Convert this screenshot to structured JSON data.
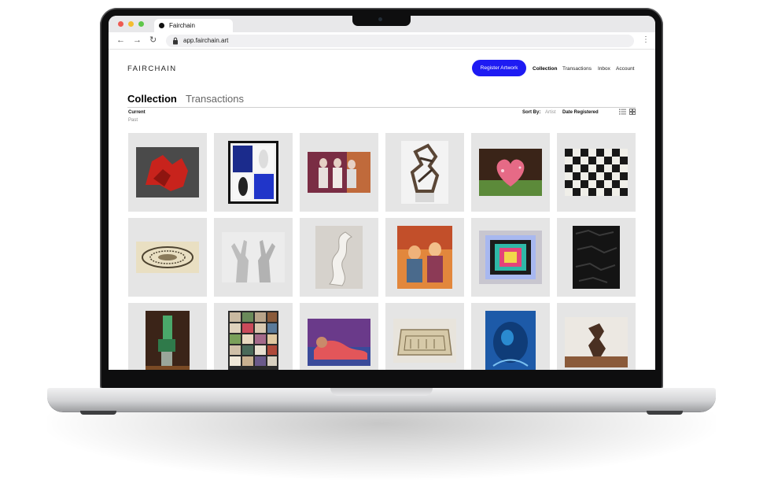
{
  "browser": {
    "tab_title": "Fairchain",
    "url": "app.fairchain.art"
  },
  "header": {
    "logo": "FAIRCHAIN",
    "register_button": "Register Artwork",
    "nav": [
      "Collection",
      "Transactions",
      "Inbox",
      "Account"
    ],
    "active_nav": "Collection"
  },
  "page": {
    "tabs": [
      "Collection",
      "Transactions"
    ],
    "active_tab": "Collection",
    "filters": [
      "Current",
      "Past"
    ],
    "active_filter": "Current",
    "sort_label": "Sort By:",
    "sort_options": [
      "Artist",
      "Date Registered"
    ],
    "active_sort": "Date Registered"
  },
  "colors": {
    "accent": "#1e1bf3",
    "tile_background": "#e5e5e5"
  },
  "artworks": [
    {
      "icon": "red-sculpture"
    },
    {
      "icon": "black-white-blue-panels"
    },
    {
      "icon": "figures-painting"
    },
    {
      "icon": "bronze-abstract-sculpture"
    },
    {
      "icon": "pink-heart-photo"
    },
    {
      "icon": "checkerboard-painting"
    },
    {
      "icon": "ornate-drawing"
    },
    {
      "icon": "hands-sculpture"
    },
    {
      "icon": "white-ribbon-sculpture"
    },
    {
      "icon": "orange-figures-painting"
    },
    {
      "icon": "concentric-squares-painting"
    },
    {
      "icon": "black-textured-panel"
    },
    {
      "icon": "green-totem-sculpture"
    },
    {
      "icon": "color-swatch-grid"
    },
    {
      "icon": "reclining-figure-painting"
    },
    {
      "icon": "ceramic-box"
    },
    {
      "icon": "blue-underwater-painting"
    },
    {
      "icon": "bronze-figure-sculpture"
    }
  ]
}
